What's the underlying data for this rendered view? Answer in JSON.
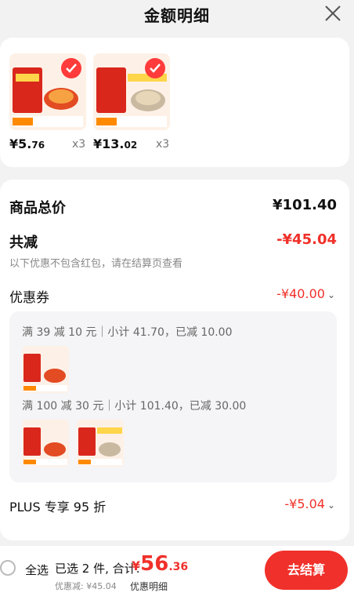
{
  "header": {
    "title": "金额明细"
  },
  "products": [
    {
      "price_int": "¥5.",
      "price_dec": "76",
      "qty": "x3"
    },
    {
      "price_int": "¥13.",
      "price_dec": "02",
      "qty": "x3"
    }
  ],
  "summary": {
    "total_label": "商品总价",
    "total_value": "¥101.40",
    "discount_label": "共减",
    "discount_value": "-¥45.04",
    "note": "以下优惠不包含红包，请在结算页查看",
    "coupon_label": "优惠券",
    "coupon_value": "-¥40.00",
    "coupon_rules": [
      {
        "text": "满 39 减 10 元｜小计 41.70，已减 10.00"
      },
      {
        "text": "满 100 减 30 元｜小计 101.40，已减 30.00"
      }
    ],
    "plus_label": "PLUS 专享 95 折",
    "plus_value": "-¥5.04"
  },
  "footer": {
    "select_all": "全选",
    "selected_text": "已选 2 件, 合计:",
    "total_currency": "¥",
    "total_int": "56",
    "total_dec": ".36",
    "discount_small": "优惠减: ¥45.04",
    "detail_link": "优惠明细",
    "checkout_label": "去结算"
  },
  "colors": {
    "accent": "#f0302a",
    "background": "#f2f2f2"
  }
}
